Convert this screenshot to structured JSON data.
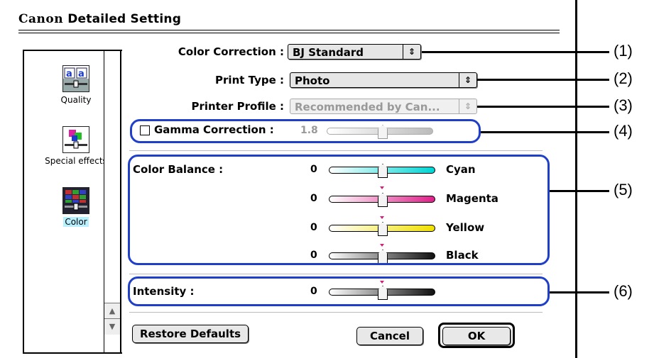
{
  "window": {
    "brand": "Canon",
    "title": "Detailed Setting"
  },
  "sidebar": {
    "items": [
      {
        "label": "Quality",
        "icon": "quality-icon"
      },
      {
        "label": "Special effects",
        "icon": "special-effects-icon"
      },
      {
        "label": "Color",
        "icon": "color-icon",
        "selected": true
      }
    ],
    "scroll_up": "▲",
    "scroll_down": "▼"
  },
  "settings": {
    "color_correction": {
      "label": "Color Correction :",
      "value": "BJ Standard"
    },
    "print_type": {
      "label": "Print Type :",
      "value": "Photo"
    },
    "printer_profile": {
      "label": "Printer Profile :",
      "value": "Recommended by Can..."
    },
    "gamma": {
      "label": "Gamma Correction :",
      "value": "1.8",
      "checked": false
    }
  },
  "color_balance": {
    "label": "Color Balance :",
    "channels": [
      {
        "name": "Cyan",
        "value": "0",
        "color": "#00d4d4"
      },
      {
        "name": "Magenta",
        "value": "0",
        "color": "#e0208a"
      },
      {
        "name": "Yellow",
        "value": "0",
        "color": "#f0e000"
      },
      {
        "name": "Black",
        "value": "0",
        "color": "#111111"
      }
    ]
  },
  "intensity": {
    "label": "Intensity :",
    "value": "0"
  },
  "buttons": {
    "restore": "Restore Defaults",
    "cancel": "Cancel",
    "ok": "OK"
  },
  "callouts": [
    "(1)",
    "(2)",
    "(3)",
    "(4)",
    "(5)",
    "(6)"
  ],
  "colors": {
    "callout_box": "#1f3fc9",
    "selected_bg": "#b8f0ff"
  }
}
